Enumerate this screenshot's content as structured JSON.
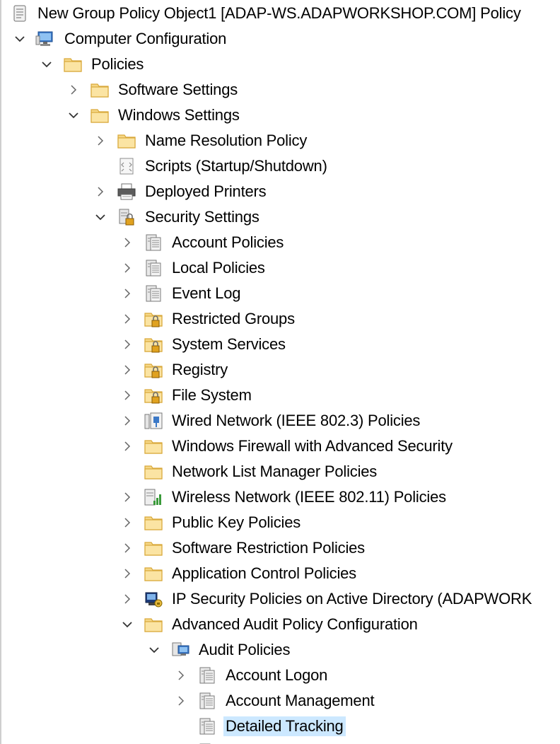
{
  "tree": {
    "root": {
      "label": "New Group Policy Object1 [ADAP-WS.ADAPWORKSHOP.COM] Policy",
      "icon": "policy-scroll-icon"
    },
    "computer_configuration": {
      "label": "Computer Configuration",
      "icon": "computer-icon",
      "expanded": true
    },
    "policies": {
      "label": "Policies",
      "icon": "folder-icon",
      "expanded": true
    },
    "software_settings": {
      "label": "Software Settings",
      "icon": "folder-icon",
      "expanded": false
    },
    "windows_settings": {
      "label": "Windows Settings",
      "icon": "folder-icon",
      "expanded": true
    },
    "name_resolution_policy": {
      "label": "Name Resolution Policy",
      "icon": "folder-icon",
      "expanded": false
    },
    "scripts": {
      "label": "Scripts (Startup/Shutdown)",
      "icon": "script-icon"
    },
    "deployed_printers": {
      "label": "Deployed Printers",
      "icon": "printer-icon",
      "expanded": false
    },
    "security_settings": {
      "label": "Security Settings",
      "icon": "security-icon",
      "expanded": true
    },
    "account_policies": {
      "label": "Account Policies",
      "icon": "policy-sheet-icon",
      "expanded": false
    },
    "local_policies": {
      "label": "Local Policies",
      "icon": "policy-sheet-icon",
      "expanded": false
    },
    "event_log": {
      "label": "Event Log",
      "icon": "policy-sheet-icon",
      "expanded": false
    },
    "restricted_groups": {
      "label": "Restricted Groups",
      "icon": "locked-folder-icon",
      "expanded": false
    },
    "system_services": {
      "label": "System Services",
      "icon": "locked-folder-icon",
      "expanded": false
    },
    "registry": {
      "label": "Registry",
      "icon": "locked-folder-icon",
      "expanded": false
    },
    "file_system": {
      "label": "File System",
      "icon": "locked-folder-icon",
      "expanded": false
    },
    "wired_network": {
      "label": "Wired Network (IEEE 802.3) Policies",
      "icon": "wired-network-icon",
      "expanded": false
    },
    "windows_firewall": {
      "label": "Windows Firewall with Advanced Security",
      "icon": "folder-icon",
      "expanded": false
    },
    "network_list_manager": {
      "label": "Network List Manager Policies",
      "icon": "folder-icon"
    },
    "wireless_network": {
      "label": "Wireless Network (IEEE 802.11) Policies",
      "icon": "wireless-network-icon",
      "expanded": false
    },
    "public_key": {
      "label": "Public Key Policies",
      "icon": "folder-icon",
      "expanded": false
    },
    "software_restriction": {
      "label": "Software Restriction Policies",
      "icon": "folder-icon",
      "expanded": false
    },
    "application_control": {
      "label": "Application Control Policies",
      "icon": "folder-icon",
      "expanded": false
    },
    "ip_security": {
      "label": "IP Security Policies on Active Directory (ADAPWORK",
      "icon": "ip-security-icon",
      "expanded": false
    },
    "advanced_audit": {
      "label": "Advanced Audit Policy Configuration",
      "icon": "folder-icon",
      "expanded": true
    },
    "audit_policies": {
      "label": "Audit Policies",
      "icon": "audit-policies-icon",
      "expanded": true
    },
    "account_logon": {
      "label": "Account Logon",
      "icon": "policy-sheet-icon",
      "expanded": false
    },
    "account_management": {
      "label": "Account Management",
      "icon": "policy-sheet-icon",
      "expanded": false
    },
    "detailed_tracking": {
      "label": "Detailed Tracking",
      "icon": "policy-sheet-icon",
      "selected": true
    }
  },
  "colors": {
    "selection": "#cce8ff",
    "folder": "#f5d787",
    "folder_edge": "#d9a93a",
    "chevron": "#666666"
  }
}
